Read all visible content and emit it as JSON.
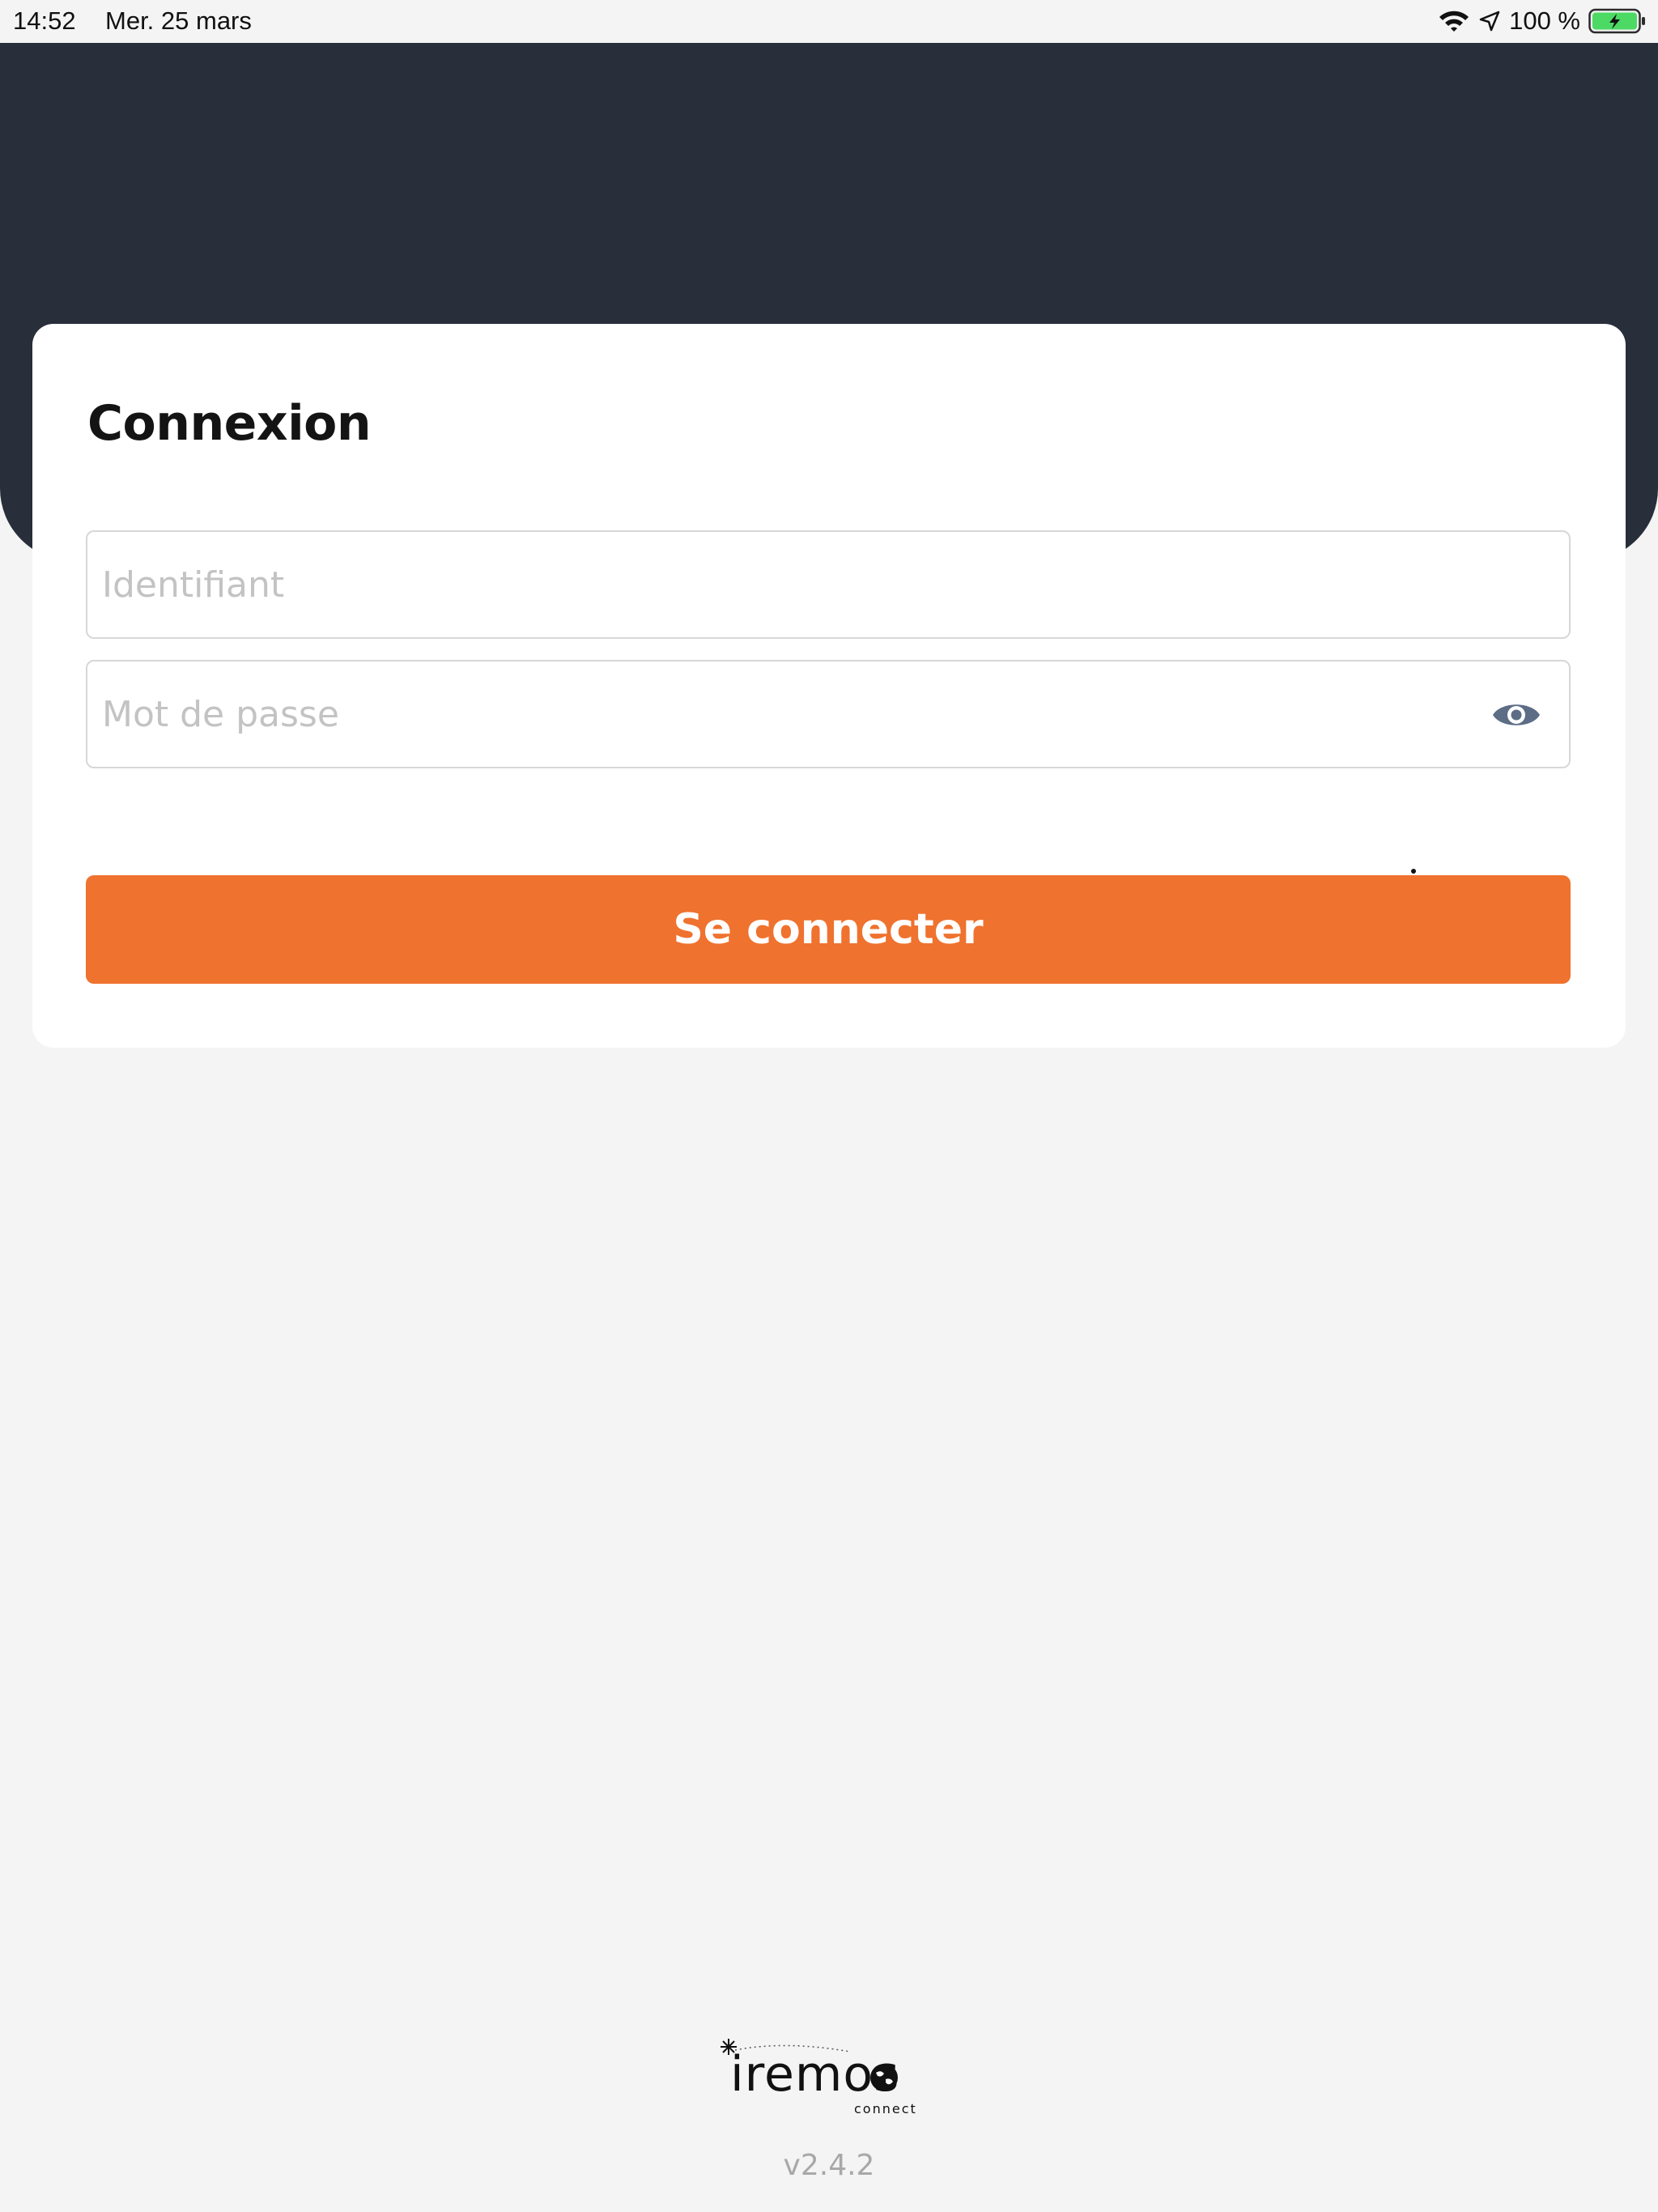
{
  "status_bar": {
    "time": "14:52",
    "date": "Mer. 25 mars",
    "battery": "100 %"
  },
  "login": {
    "title": "Connexion",
    "username_placeholder": "Identifiant",
    "password_placeholder": "Mot de passe",
    "submit_label": "Se connecter"
  },
  "footer": {
    "logo_text": "iremos",
    "logo_subtext": "connect",
    "version": "v2.4.2"
  },
  "colors": {
    "header": "#282e3a",
    "accent": "#ef722e",
    "background": "#f4f4f4"
  }
}
